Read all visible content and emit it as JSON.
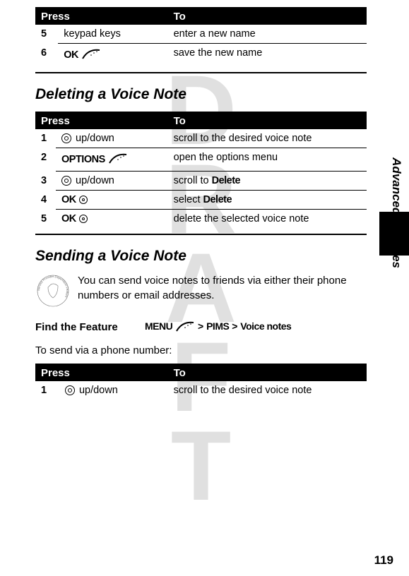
{
  "tableHeaders": {
    "press": "Press",
    "to": "To"
  },
  "table1": {
    "rows": [
      {
        "num": "5",
        "press": "keypad keys",
        "to": "enter a new name"
      },
      {
        "num": "6",
        "press_label": "OK",
        "to": "save the new name",
        "icon": "softkey"
      }
    ]
  },
  "heading1": "Deleting a Voice Note",
  "table2": {
    "rows": [
      {
        "num": "1",
        "press_suffix": " up/down",
        "to": "scroll to the desired voice note",
        "icon": "dpad"
      },
      {
        "num": "2",
        "press_label": "OPTIONS",
        "to": "open the options menu",
        "icon": "softkey"
      },
      {
        "num": "3",
        "press_suffix": " up/down",
        "to_prefix": "scroll to ",
        "to_bold": "Delete",
        "icon": "dpad"
      },
      {
        "num": "4",
        "press_label": "OK",
        "to_prefix": "select ",
        "to_bold": "Delete",
        "icon": "dpad-small"
      },
      {
        "num": "5",
        "press_label": "OK",
        "to": "delete the selected voice note",
        "icon": "dpad-small"
      }
    ]
  },
  "heading2": "Sending a Voice Note",
  "paragraph": "You can send voice notes to friends via either their phone numbers or email addresses.",
  "findFeature": {
    "label": "Find the Feature",
    "menu": "MENU",
    "sep": ">",
    "path1": "PIMS",
    "path2": "Voice notes"
  },
  "introLine": "To send via a phone number:",
  "table3": {
    "rows": [
      {
        "num": "1",
        "press_suffix": " up/down",
        "to": "scroll to the desired voice note",
        "icon": "dpad"
      }
    ]
  },
  "sideLabel": "Advanced Features",
  "pageNumber": "119",
  "watermark": "DRAFT",
  "badgeText": "Service Provider Dependent Feature"
}
